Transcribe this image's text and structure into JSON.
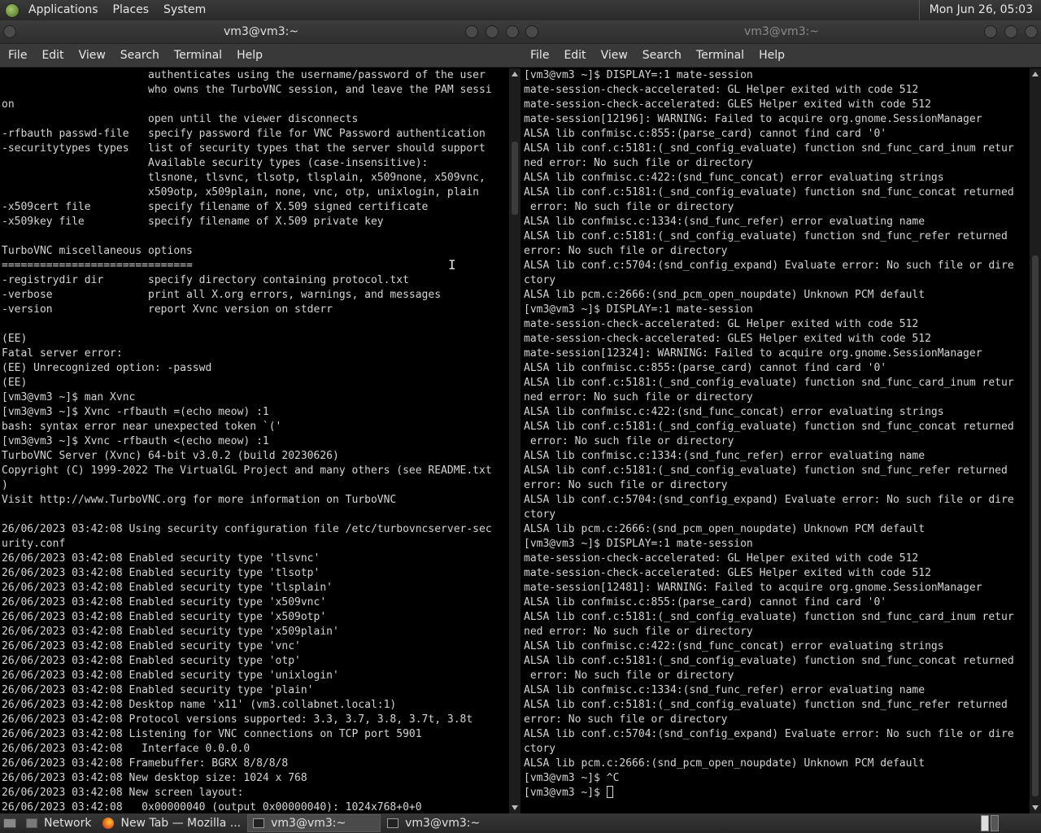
{
  "top_panel": {
    "menus": [
      "Applications",
      "Places",
      "System"
    ],
    "clock": "Mon Jun 26, 05:03"
  },
  "left_window": {
    "title": "vm3@vm3:~",
    "menu": [
      "File",
      "Edit",
      "View",
      "Search",
      "Terminal",
      "Help"
    ],
    "lines": [
      "                       authenticates using the username/password of the user",
      "                       who owns the TurboVNC session, and leave the PAM sessi",
      "on",
      "                       open until the viewer disconnects",
      "-rfbauth passwd-file   specify password file for VNC Password authentication",
      "-securitytypes types   list of security types that the server should support",
      "                       Available security types (case-insensitive):",
      "                       tlsnone, tlsvnc, tlsotp, tlsplain, x509none, x509vnc,",
      "                       x509otp, x509plain, none, vnc, otp, unixlogin, plain",
      "-x509cert file         specify filename of X.509 signed certificate",
      "-x509key file          specify filename of X.509 private key",
      "",
      "TurboVNC miscellaneous options",
      "==============================",
      "-registrydir dir       specify directory containing protocol.txt",
      "-verbose               print all X.org errors, warnings, and messages",
      "-version               report Xvnc version on stderr",
      "",
      "(EE)",
      "Fatal server error:",
      "(EE) Unrecognized option: -passwd",
      "(EE)",
      "[vm3@vm3 ~]$ man Xvnc",
      "[vm3@vm3 ~]$ Xvnc -rfbauth =(echo meow) :1",
      "bash: syntax error near unexpected token `('",
      "[vm3@vm3 ~]$ Xvnc -rfbauth <(echo meow) :1",
      "TurboVNC Server (Xvnc) 64-bit v3.0.2 (build 20230626)",
      "Copyright (C) 1999-2022 The VirtualGL Project and many others (see README.txt",
      ")",
      "Visit http://www.TurboVNC.org for more information on TurboVNC",
      "",
      "26/06/2023 03:42:08 Using security configuration file /etc/turbovncserver-sec",
      "urity.conf",
      "26/06/2023 03:42:08 Enabled security type 'tlsvnc'",
      "26/06/2023 03:42:08 Enabled security type 'tlsotp'",
      "26/06/2023 03:42:08 Enabled security type 'tlsplain'",
      "26/06/2023 03:42:08 Enabled security type 'x509vnc'",
      "26/06/2023 03:42:08 Enabled security type 'x509otp'",
      "26/06/2023 03:42:08 Enabled security type 'x509plain'",
      "26/06/2023 03:42:08 Enabled security type 'vnc'",
      "26/06/2023 03:42:08 Enabled security type 'otp'",
      "26/06/2023 03:42:08 Enabled security type 'unixlogin'",
      "26/06/2023 03:42:08 Enabled security type 'plain'",
      "26/06/2023 03:42:08 Desktop name 'x11' (vm3.collabnet.local:1)",
      "26/06/2023 03:42:08 Protocol versions supported: 3.3, 3.7, 3.8, 3.7t, 3.8t",
      "26/06/2023 03:42:08 Listening for VNC connections on TCP port 5901",
      "26/06/2023 03:42:08   Interface 0.0.0.0",
      "26/06/2023 03:42:08 Framebuffer: BGRX 8/8/8/8",
      "26/06/2023 03:42:08 New desktop size: 1024 x 768",
      "26/06/2023 03:42:08 New screen layout:",
      "26/06/2023 03:42:08   0x00000040 (output 0x00000040): 1024x768+0+0"
    ]
  },
  "right_window": {
    "title": "vm3@vm3:~",
    "menu": [
      "File",
      "Edit",
      "View",
      "Search",
      "Terminal",
      "Help"
    ],
    "lines": [
      "[vm3@vm3 ~]$ DISPLAY=:1 mate-session",
      "mate-session-check-accelerated: GL Helper exited with code 512",
      "mate-session-check-accelerated: GLES Helper exited with code 512",
      "mate-session[12196]: WARNING: Failed to acquire org.gnome.SessionManager",
      "ALSA lib confmisc.c:855:(parse_card) cannot find card '0'",
      "ALSA lib conf.c:5181:(_snd_config_evaluate) function snd_func_card_inum retur",
      "ned error: No such file or directory",
      "ALSA lib confmisc.c:422:(snd_func_concat) error evaluating strings",
      "ALSA lib conf.c:5181:(_snd_config_evaluate) function snd_func_concat returned",
      " error: No such file or directory",
      "ALSA lib confmisc.c:1334:(snd_func_refer) error evaluating name",
      "ALSA lib conf.c:5181:(_snd_config_evaluate) function snd_func_refer returned",
      "error: No such file or directory",
      "ALSA lib conf.c:5704:(snd_config_expand) Evaluate error: No such file or dire",
      "ctory",
      "ALSA lib pcm.c:2666:(snd_pcm_open_noupdate) Unknown PCM default",
      "[vm3@vm3 ~]$ DISPLAY=:1 mate-session",
      "mate-session-check-accelerated: GL Helper exited with code 512",
      "mate-session-check-accelerated: GLES Helper exited with code 512",
      "mate-session[12324]: WARNING: Failed to acquire org.gnome.SessionManager",
      "ALSA lib confmisc.c:855:(parse_card) cannot find card '0'",
      "ALSA lib conf.c:5181:(_snd_config_evaluate) function snd_func_card_inum retur",
      "ned error: No such file or directory",
      "ALSA lib confmisc.c:422:(snd_func_concat) error evaluating strings",
      "ALSA lib conf.c:5181:(_snd_config_evaluate) function snd_func_concat returned",
      " error: No such file or directory",
      "ALSA lib confmisc.c:1334:(snd_func_refer) error evaluating name",
      "ALSA lib conf.c:5181:(_snd_config_evaluate) function snd_func_refer returned",
      "error: No such file or directory",
      "ALSA lib conf.c:5704:(snd_config_expand) Evaluate error: No such file or dire",
      "ctory",
      "ALSA lib pcm.c:2666:(snd_pcm_open_noupdate) Unknown PCM default",
      "[vm3@vm3 ~]$ DISPLAY=:1 mate-session",
      "mate-session-check-accelerated: GL Helper exited with code 512",
      "mate-session-check-accelerated: GLES Helper exited with code 512",
      "mate-session[12481]: WARNING: Failed to acquire org.gnome.SessionManager",
      "ALSA lib confmisc.c:855:(parse_card) cannot find card '0'",
      "ALSA lib conf.c:5181:(_snd_config_evaluate) function snd_func_card_inum retur",
      "ned error: No such file or directory",
      "ALSA lib confmisc.c:422:(snd_func_concat) error evaluating strings",
      "ALSA lib conf.c:5181:(_snd_config_evaluate) function snd_func_concat returned",
      " error: No such file or directory",
      "ALSA lib confmisc.c:1334:(snd_func_refer) error evaluating name",
      "ALSA lib conf.c:5181:(_snd_config_evaluate) function snd_func_refer returned",
      "error: No such file or directory",
      "ALSA lib conf.c:5704:(snd_config_expand) Evaluate error: No such file or dire",
      "ctory",
      "ALSA lib pcm.c:2666:(snd_pcm_open_noupdate) Unknown PCM default",
      "[vm3@vm3 ~]$ ^C"
    ],
    "prompt": "[vm3@vm3 ~]$ "
  },
  "taskbar": {
    "items": [
      {
        "label": "Network",
        "icon": "folder-icon"
      },
      {
        "label": "New Tab — Mozilla ...",
        "icon": "firefox-icon"
      },
      {
        "label": "vm3@vm3:~",
        "icon": "terminal-icon",
        "active": true
      },
      {
        "label": "vm3@vm3:~",
        "icon": "terminal-icon"
      }
    ]
  }
}
